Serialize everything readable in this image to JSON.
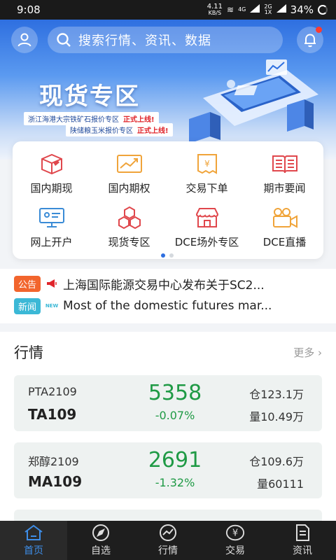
{
  "status_bar": {
    "time": "9:08",
    "net_speed": "4.11",
    "net_unit": "KB/S",
    "signal_1": "4G",
    "signal_2": "2G",
    "signal_2_sub": "1X",
    "battery": "34%"
  },
  "header": {
    "search_placeholder": "搜索行情、资讯、数据"
  },
  "banner": {
    "title": "现货专区",
    "tags": [
      {
        "text": "浙江海港大宗铁矿石报价专区",
        "hot": "正式上线!"
      },
      {
        "text": "陕储粮玉米报价专区",
        "hot": "正式上线!"
      }
    ]
  },
  "menu": {
    "items": [
      {
        "label": "国内期现",
        "icon": "gem-box-icon"
      },
      {
        "label": "国内期权",
        "icon": "trend-chart-icon"
      },
      {
        "label": "交易下单",
        "icon": "receipt-icon"
      },
      {
        "label": "期市要闻",
        "icon": "newspaper-icon"
      },
      {
        "label": "网上开户",
        "icon": "monitor-icon"
      },
      {
        "label": "现货专区",
        "icon": "hexagons-icon"
      },
      {
        "label": "DCE场外专区",
        "icon": "shop-icon"
      },
      {
        "label": "DCE直播",
        "icon": "video-camera-icon"
      }
    ],
    "page_count": 2,
    "active_page": 1
  },
  "ticker": {
    "notice_badge": "公告",
    "notice_text": "上海国际能源交易中心发布关于SC2...",
    "news_badge": "新闻",
    "news_tag": "NEW",
    "news_text": "Most of the domestic futures mar..."
  },
  "market": {
    "title": "行情",
    "more": "更多 ›",
    "quotes": [
      {
        "name": "PTA2109",
        "code": "TA109",
        "price": "5358",
        "change": "-0.07%",
        "open_interest": "仓123.1万",
        "volume": "量10.49万"
      },
      {
        "name": "郑醇2109",
        "code": "MA109",
        "price": "2691",
        "change": "-1.32%",
        "open_interest": "仓109.6万",
        "volume": "量60111"
      }
    ]
  },
  "tabbar": {
    "tabs": [
      {
        "label": "首页",
        "icon": "home-icon"
      },
      {
        "label": "自选",
        "icon": "compass-icon"
      },
      {
        "label": "行情",
        "icon": "chart-line-icon"
      },
      {
        "label": "交易",
        "icon": "yen-icon"
      },
      {
        "label": "资讯",
        "icon": "document-icon"
      }
    ],
    "active": "首页"
  },
  "colors": {
    "accent": "#2e6fe0",
    "down": "#1f9a45",
    "notice": "#f2652d",
    "news": "#3bb8d6",
    "icon_red": "#e0474c",
    "icon_orange": "#f0a43a"
  }
}
